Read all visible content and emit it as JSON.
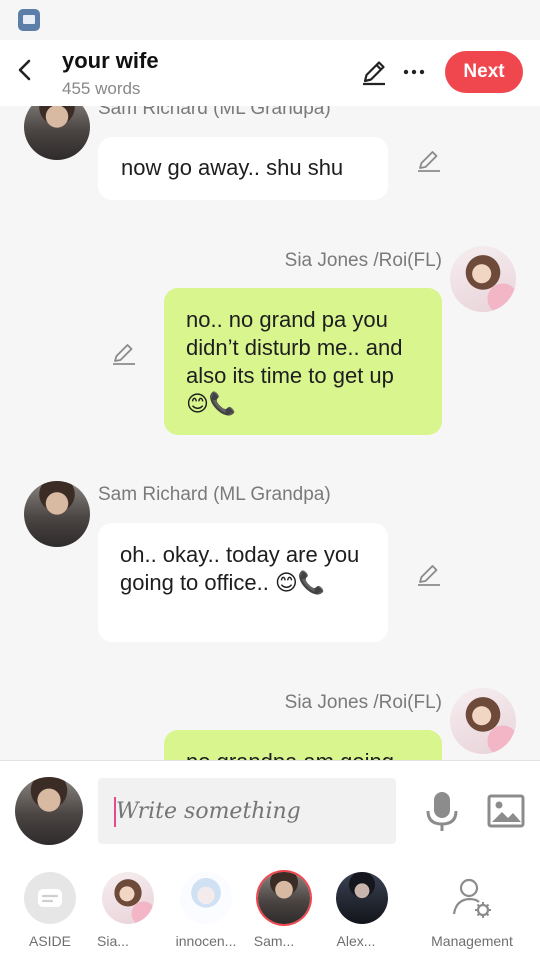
{
  "header": {
    "title": "your wife",
    "word_count": "455 words",
    "next_label": "Next"
  },
  "messages": [
    {
      "side": "left",
      "speaker": "Sam Richard  (ML Grandpa)",
      "text": "now go away.. shu shu"
    },
    {
      "side": "right",
      "speaker": "Sia Jones /Roi(FL)",
      "text": "no.. no grand pa you didn’t disturb me.. and also its time to get up 😊📞"
    },
    {
      "side": "left",
      "speaker": "Sam Richard  (ML Grandpa)",
      "text": "oh.. okay.. today are you going to office.. 😊📞"
    },
    {
      "side": "right",
      "speaker": "Sia Jones /Roi(FL)",
      "text": "no grandpa am going"
    }
  ],
  "composer": {
    "placeholder": "Write something"
  },
  "characters": [
    {
      "label": "ASIDE"
    },
    {
      "label": "Sia..."
    },
    {
      "label": "innocen..."
    },
    {
      "label": "Sam..."
    },
    {
      "label": "Alex..."
    },
    {
      "label": "Management"
    }
  ],
  "colors": {
    "accent": "#f0474e",
    "right_bubble": "#d8f58e",
    "left_bubble": "#ffffff",
    "background": "#f6f6f6"
  }
}
